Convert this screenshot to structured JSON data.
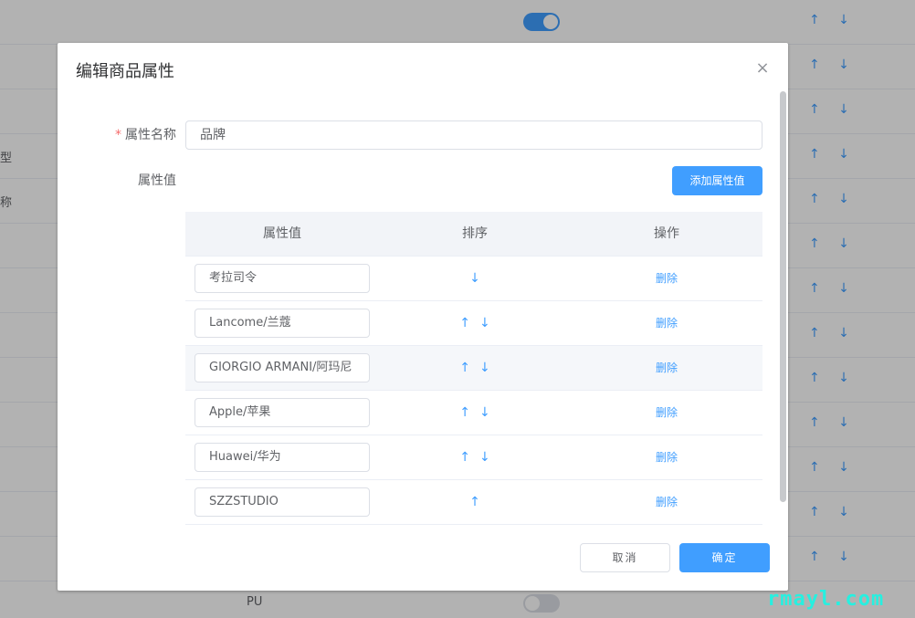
{
  "background": {
    "left_texts": [
      "型",
      "称"
    ],
    "row_arrows": "↑ ↓",
    "bottom_text": "PU"
  },
  "dialog": {
    "title": "编辑商品属性",
    "close_icon": "close-icon",
    "name_label": "属性名称",
    "required_mark": "*",
    "name_value": "品牌",
    "values_label": "属性值",
    "add_button": "添加属性值",
    "table": {
      "headers": [
        "属性值",
        "排序",
        "操作"
      ],
      "rows": [
        {
          "value": "考拉司令",
          "up": "",
          "down": "↓",
          "action": "删除"
        },
        {
          "value": "Lancome/兰蔻",
          "up": "↑",
          "down": "↓",
          "action": "删除"
        },
        {
          "value": "GIORGIO ARMANI/阿玛尼",
          "up": "↑",
          "down": "↓",
          "action": "删除"
        },
        {
          "value": "Apple/苹果",
          "up": "↑",
          "down": "↓",
          "action": "删除"
        },
        {
          "value": "Huawei/华为",
          "up": "↑",
          "down": "↓",
          "action": "删除"
        },
        {
          "value": "SZZSTUDIO",
          "up": "↑",
          "down": "",
          "action": "删除"
        }
      ]
    },
    "cancel_button": "取消",
    "confirm_button": "确定"
  },
  "watermark": "rmayl.com",
  "colors": {
    "primary": "#409eff",
    "required": "#f56c6c",
    "overlay": "rgba(0,0,0,0.3)"
  }
}
